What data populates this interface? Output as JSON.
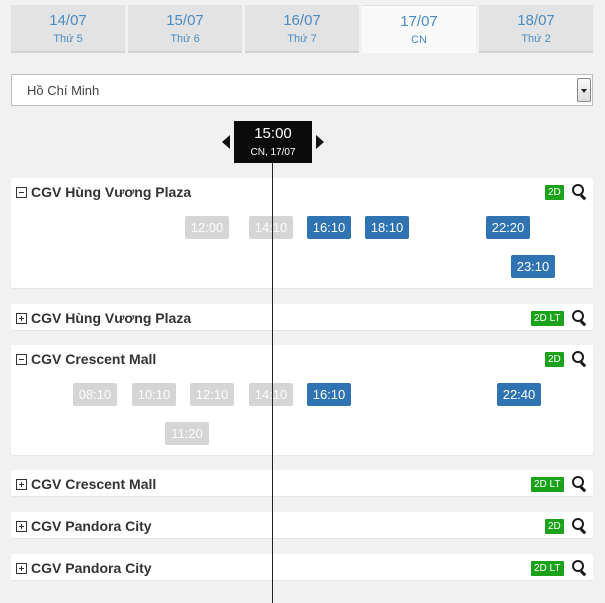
{
  "date_tabs": [
    {
      "date": "14/07",
      "weekday": "Thứ 5"
    },
    {
      "date": "15/07",
      "weekday": "Thứ 6"
    },
    {
      "date": "16/07",
      "weekday": "Thứ 7"
    },
    {
      "date": "17/07",
      "weekday": "CN"
    },
    {
      "date": "18/07",
      "weekday": "Thứ 2"
    }
  ],
  "city_select": {
    "value": "Hồ Chí Minh"
  },
  "time_marker": {
    "time": "15:00",
    "date": "CN, 17/07"
  },
  "cinemas": [
    {
      "name": "CGV Hùng Vương Plaza",
      "format": "2D",
      "showtimes": [
        "12:00",
        "14:10",
        "16:10",
        "18:10",
        "22:20",
        "23:10"
      ]
    },
    {
      "name": "CGV Hùng Vương Plaza",
      "format": "2D LT"
    },
    {
      "name": "CGV Crescent Mall",
      "format": "2D",
      "showtimes": [
        "08:10",
        "10:10",
        "12:10",
        "14:10",
        "16:10",
        "22:40",
        "11:20"
      ]
    },
    {
      "name": "CGV Crescent Mall",
      "format": "2D LT"
    },
    {
      "name": "CGV Pandora City",
      "format": "2D"
    },
    {
      "name": "CGV Pandora City",
      "format": "2D LT"
    }
  ]
}
